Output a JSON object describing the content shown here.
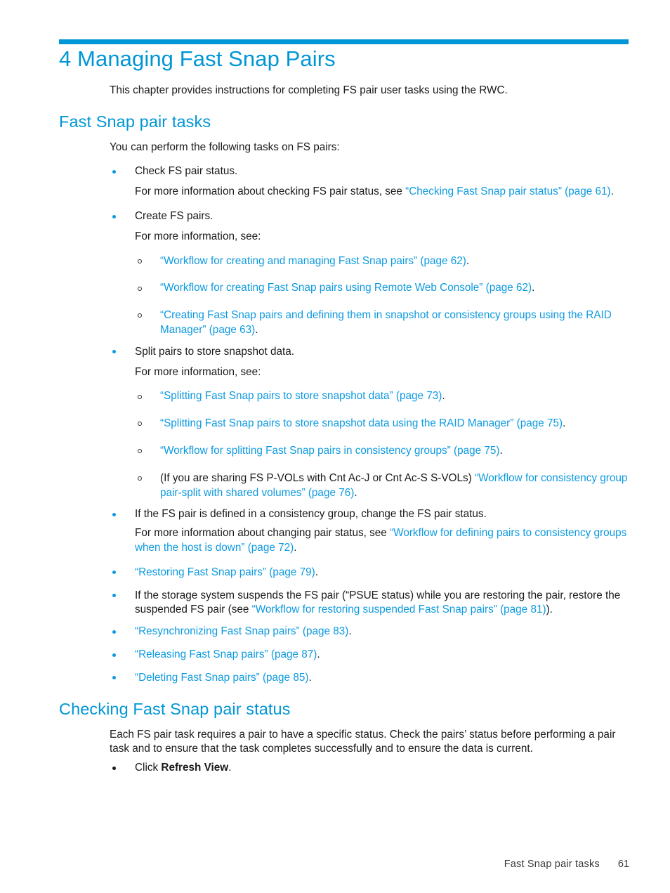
{
  "accent_color": "#0096d6",
  "link_color": "#0d9ae0",
  "body_color": "#1a1a1a",
  "chapter": {
    "title": "4 Managing Fast Snap Pairs",
    "intro": "This chapter provides instructions for completing FS pair user tasks using the RWC."
  },
  "sections": [
    {
      "heading": "Fast Snap pair tasks",
      "intro": "You can perform the following tasks on FS pairs:",
      "items": [
        {
          "text": "Check FS pair status.",
          "bullet_color": "#0d9ae0",
          "sub_paragraph_prefix": "For more information about checking FS pair status, see ",
          "sub_paragraph_link": "“Checking Fast Snap pair status” (page 61)",
          "sub_paragraph_suffix": "."
        },
        {
          "text": "Create FS pairs.",
          "bullet_color": "#0d9ae0",
          "sub_paragraph_prefix": "For more information, see:",
          "subitems": [
            {
              "link": "“Workflow for creating and managing Fast Snap pairs” (page 62)",
              "suffix": "."
            },
            {
              "link": "“Workflow for creating Fast Snap pairs using Remote Web Console” (page 62)",
              "suffix": "."
            },
            {
              "link": "“Creating Fast Snap pairs and defining them in snapshot or consistency groups using the RAID Manager” (page 63)",
              "suffix": "."
            }
          ]
        },
        {
          "text": "Split pairs to store snapshot data.",
          "bullet_color": "#0d9ae0",
          "sub_paragraph_prefix": "For more information, see:",
          "subitems": [
            {
              "link": "“Splitting Fast Snap pairs to store snapshot data” (page 73)",
              "suffix": "."
            },
            {
              "link": "“Splitting Fast Snap pairs to store snapshot data using the RAID Manager” (page 75)",
              "suffix": "."
            },
            {
              "link": "“Workflow for splitting Fast Snap pairs in consistency groups” (page 75)",
              "suffix": "."
            },
            {
              "prefix": "(If you are sharing FS P-VOLs with Cnt Ac-J or Cnt Ac-S S-VOLs) ",
              "link": "“Workflow for consistency group pair-split with shared volumes” (page 76)",
              "suffix": "."
            }
          ]
        },
        {
          "text": "If the FS pair is defined in a consistency group, change the FS pair status.",
          "bullet_color": "#0d9ae0",
          "sub_paragraph_prefix": "For more information about changing pair status, see ",
          "sub_paragraph_link": "“Workflow for defining pairs to consistency groups when the host is down” (page 72)",
          "sub_paragraph_suffix": "."
        },
        {
          "link_only": true,
          "bullet_color": "#0d9ae0",
          "link": "“Restoring Fast Snap pairs” (page 79)",
          "suffix": "."
        },
        {
          "bullet_color": "#0d9ae0",
          "mixed": true,
          "prefix": "If the storage system suspends the FS pair (“PSUE status) while you are restoring the pair, restore the suspended FS pair (see ",
          "link": "“Workflow for restoring suspended Fast Snap pairs” (page 81)",
          "suffix": ")."
        },
        {
          "link_only": true,
          "bullet_color": "#0d9ae0",
          "link": "“Resynchronizing Fast Snap pairs” (page 83)",
          "suffix": "."
        },
        {
          "link_only": true,
          "bullet_color": "#0d9ae0",
          "link": "“Releasing Fast Snap pairs” (page 87)",
          "suffix": "."
        },
        {
          "link_only": true,
          "bullet_color": "#0d9ae0",
          "link": "“Deleting Fast Snap pairs” (page 85)",
          "suffix": "."
        }
      ]
    },
    {
      "heading": "Checking Fast Snap pair status",
      "intro": "Each FS pair task requires a pair to have a specific status. Check the pairs’ status before performing a pair task and to ensure that the task completes successfully and to ensure the data is current.",
      "steps": [
        {
          "prefix": "Click ",
          "bold": "Refresh View",
          "suffix": "."
        }
      ]
    }
  ],
  "footer": {
    "section": "Fast Snap pair tasks",
    "page": "61"
  }
}
